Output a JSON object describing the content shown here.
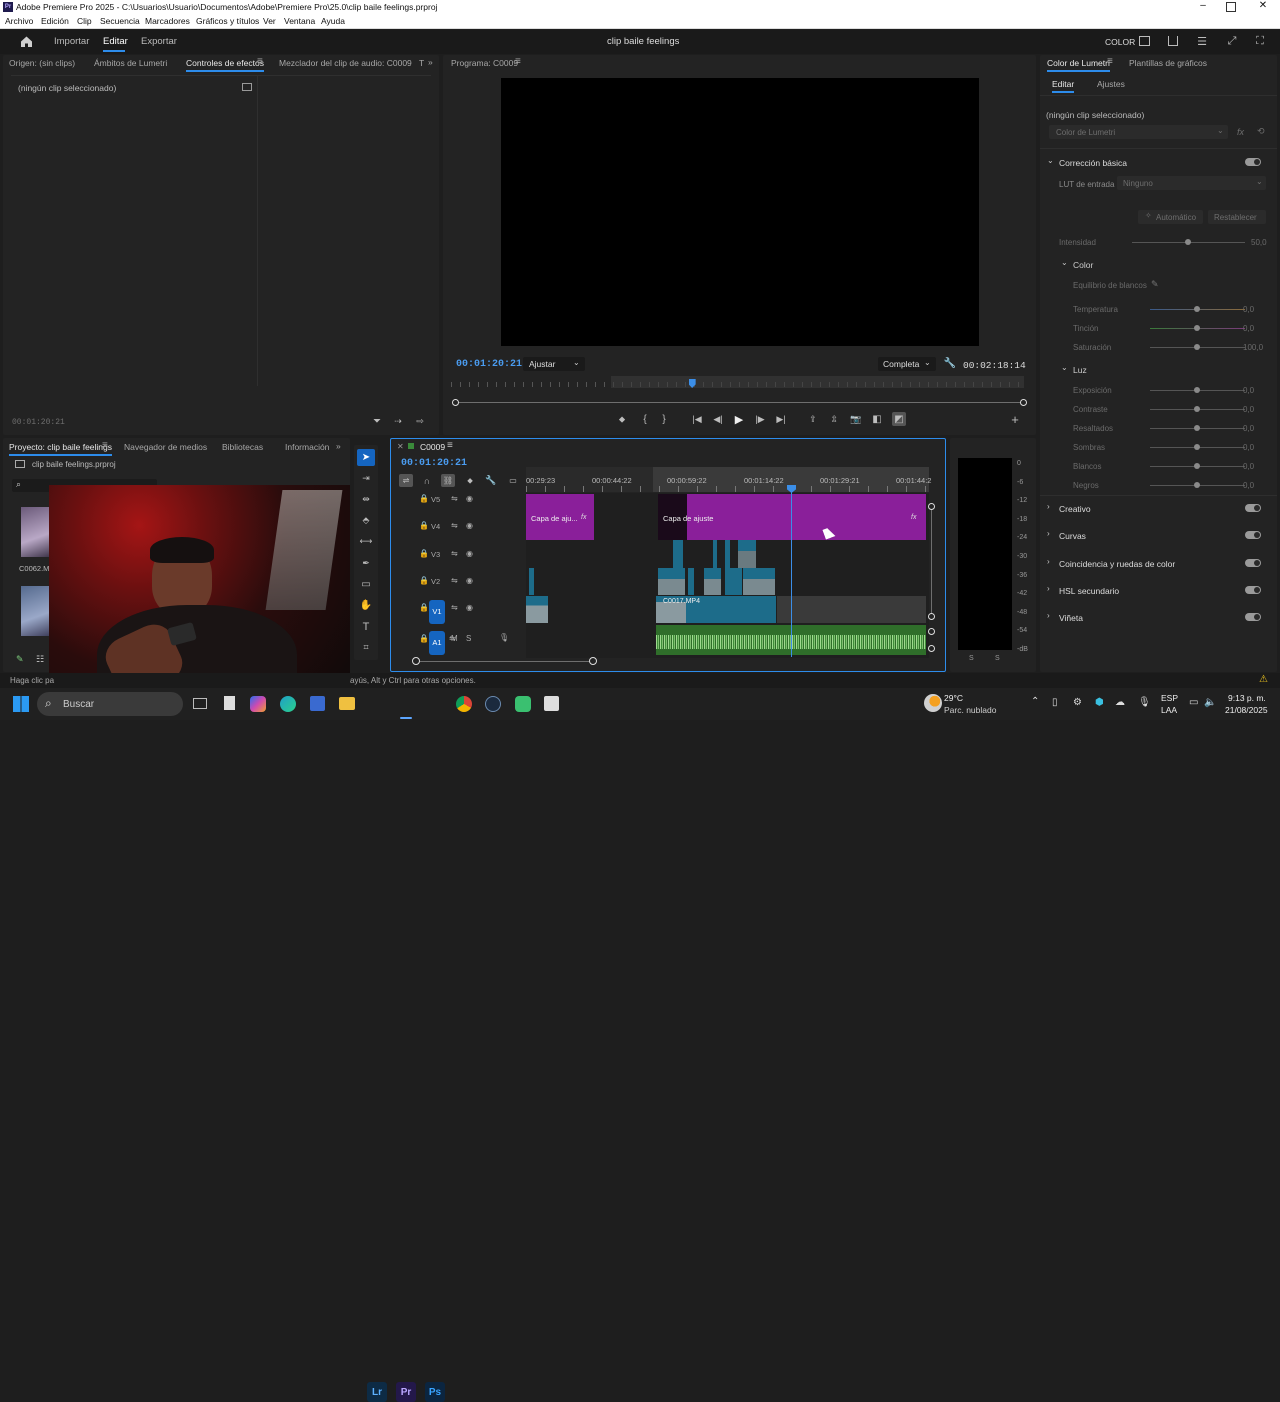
{
  "window": {
    "title": "Adobe Premiere Pro 2025 - C:\\Usuarios\\Usuario\\Documentos\\Adobe\\Premiere Pro\\25.0\\clip baile feelings.prproj",
    "logo": "Pr"
  },
  "menu": [
    "Archivo",
    "Edición",
    "Clip",
    "Secuencia",
    "Marcadores",
    "Gráficos y títulos",
    "Ver",
    "Ventana",
    "Ayuda"
  ],
  "header": {
    "tabs": [
      "Importar",
      "Editar",
      "Exportar"
    ],
    "project_name": "clip baile feelings",
    "color_label": "COLOR"
  },
  "source_panel": {
    "tabs": [
      "Origen: (sin clips)",
      "Ámbitos de Lumetri",
      "Controles de efectos",
      "Mezclador del clip de audio: C0009",
      "T"
    ],
    "message": "(ningún clip seleccionado)",
    "timecode": "00:01:20:21"
  },
  "program": {
    "tab": "Programa: C0009",
    "timecode": "00:01:20:21",
    "fit": "Ajustar",
    "quality": "Completa",
    "duration": "00:02:18:14",
    "playhead_fraction": 0.42
  },
  "lumetri": {
    "tabs": [
      "Color de Lumetri",
      "Plantillas de gráficos"
    ],
    "subtabs": [
      "Editar",
      "Ajustes"
    ],
    "no_clip": "(ningún clip seleccionado)",
    "preset": "Color de Lumetri",
    "fx": "fx",
    "basic": {
      "title": "Corrección básica",
      "lut_label": "LUT de entrada",
      "lut_value": "Ninguno",
      "auto": "Automático",
      "reset": "Restablecer",
      "intensity_label": "Intensidad",
      "intensity_value": "50,0"
    },
    "color": {
      "title": "Color",
      "wb": "Equilibrio de blancos",
      "rows": [
        {
          "label": "Temperatura",
          "value": "0,0"
        },
        {
          "label": "Tinción",
          "value": "0,0"
        },
        {
          "label": "Saturación",
          "value": "100,0"
        }
      ]
    },
    "light": {
      "title": "Luz",
      "rows": [
        {
          "label": "Exposición",
          "value": "0,0"
        },
        {
          "label": "Contraste",
          "value": "0,0"
        },
        {
          "label": "Resaltados",
          "value": "0,0"
        },
        {
          "label": "Sombras",
          "value": "0,0"
        },
        {
          "label": "Blancos",
          "value": "0,0"
        },
        {
          "label": "Negros",
          "value": "0,0"
        }
      ]
    },
    "sections": [
      "Creativo",
      "Curvas",
      "Coincidencia y ruedas de color",
      "HSL secundario",
      "Viñeta"
    ]
  },
  "project": {
    "tabs": [
      "Proyecto: clip baile feelings",
      "Navegador de medios",
      "Bibliotecas",
      "Información"
    ],
    "file": "clip baile feelings.prproj",
    "item": "C0062.M"
  },
  "timeline": {
    "tab": "C0009",
    "timecode": "00:01:20:21",
    "ruler": [
      "00:29:23",
      "00:00:44:22",
      "00:00:59:22",
      "00:01:14:22",
      "00:01:29:21",
      "00:01:44:2"
    ],
    "tracks": [
      "V5",
      "V4",
      "V3",
      "V2",
      "V1",
      "A1"
    ],
    "clip_labels": {
      "adj1": "Capa de aju...",
      "adj2": "Capa de ajuste",
      "video": "C0017.MP4"
    },
    "fx": "fx"
  },
  "meter": {
    "scale": [
      "0",
      "-6",
      "-12",
      "-18",
      "-24",
      "-30",
      "-36",
      "-42",
      "-48",
      "-54",
      "-dB"
    ],
    "solo": [
      "S",
      "S"
    ]
  },
  "status": {
    "left": "Haga clic pa",
    "right": "ayús, Alt y Ctrl para otras opciones."
  },
  "taskbar": {
    "search": "Buscar",
    "weather_temp": "29°C",
    "weather_desc": "Parc. nublado",
    "lang1": "ESP",
    "lang2": "LAA",
    "time": "9:13 p. m.",
    "date": "21/08/2025",
    "apps": [
      {
        "label": "Lr",
        "color": "#0d2b45",
        "fg": "#5db1ff"
      },
      {
        "label": "Pr",
        "color": "#23184a",
        "fg": "#b9a6ff"
      },
      {
        "label": "Ps",
        "color": "#0b2540",
        "fg": "#39a4ff"
      }
    ]
  }
}
